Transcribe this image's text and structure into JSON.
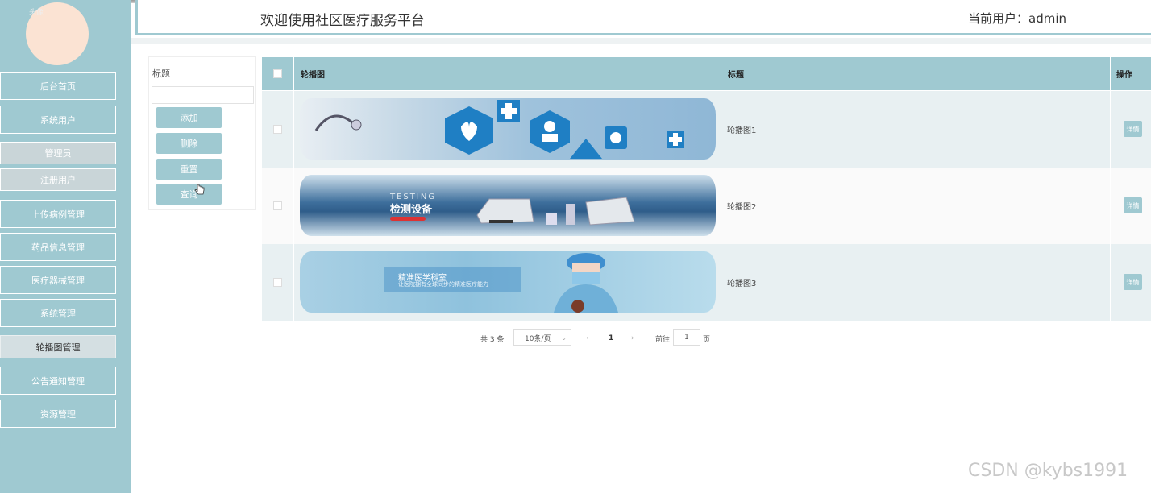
{
  "header": {
    "welcome": "欢迎使用社区医疗服务平台",
    "current_user": "当前用户：admin"
  },
  "avatar_alt": "头像",
  "sidebar": {
    "items": [
      {
        "label": "后台首页"
      },
      {
        "label": "系统用户"
      },
      {
        "label": "管理员"
      },
      {
        "label": "注册用户"
      },
      {
        "label": "上传病例管理"
      },
      {
        "label": "药品信息管理"
      },
      {
        "label": "医疗器械管理"
      },
      {
        "label": "系统管理"
      },
      {
        "label": "轮播图管理"
      },
      {
        "label": "公告通知管理"
      },
      {
        "label": "资源管理"
      }
    ],
    "active": "轮播图管理"
  },
  "search": {
    "label": "标题",
    "value": "",
    "buttons": {
      "add": "添加",
      "delete": "删除",
      "reset": "重置",
      "query": "查询"
    }
  },
  "table": {
    "headers": {
      "image": "轮播图",
      "title": "标题",
      "action": "操作"
    },
    "rows": [
      {
        "title": "轮播图1",
        "action": "详情"
      },
      {
        "title": "轮播图2",
        "action": "详情",
        "banner_text": "检测设备",
        "banner_sub": "TESTING"
      },
      {
        "title": "轮播图3",
        "action": "详情",
        "banner_text": "精准医学科室",
        "banner_sub": "让医院拥有全球同步的精准医疗能力"
      }
    ]
  },
  "pagination": {
    "total": "共 3 条",
    "page_size": "10条/页",
    "current": "1",
    "goto_label": "前往",
    "goto_value": "1",
    "page_suffix": "页"
  },
  "watermark": "CSDN @kybs1991",
  "colors": {
    "accent": "#9fc9d1",
    "sidebar": "#9fc9d1",
    "active_nav": "#d4dfe2"
  }
}
